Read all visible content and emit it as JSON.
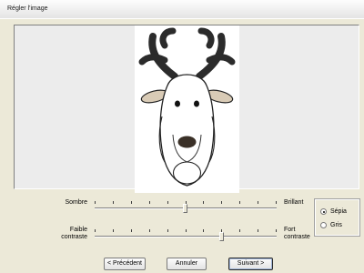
{
  "window": {
    "title": "Régler l'image"
  },
  "preview": {
    "image": "reindeer-head-drawing"
  },
  "brightness": {
    "low_label": "Sombre",
    "high_label": "Brillant",
    "value_percent": 50,
    "ticks": 11
  },
  "contrast": {
    "low_label_1": "Faible",
    "low_label_2": "contraste",
    "high_label_1": "Fort",
    "high_label_2": "contraste",
    "value_percent": 70,
    "ticks": 11
  },
  "tone": {
    "options": [
      {
        "label": "Sépia",
        "selected": true
      },
      {
        "label": "Gris",
        "selected": false
      }
    ]
  },
  "buttons": {
    "previous": "< Précédent",
    "cancel": "Annuler",
    "next": "Suivant >"
  }
}
